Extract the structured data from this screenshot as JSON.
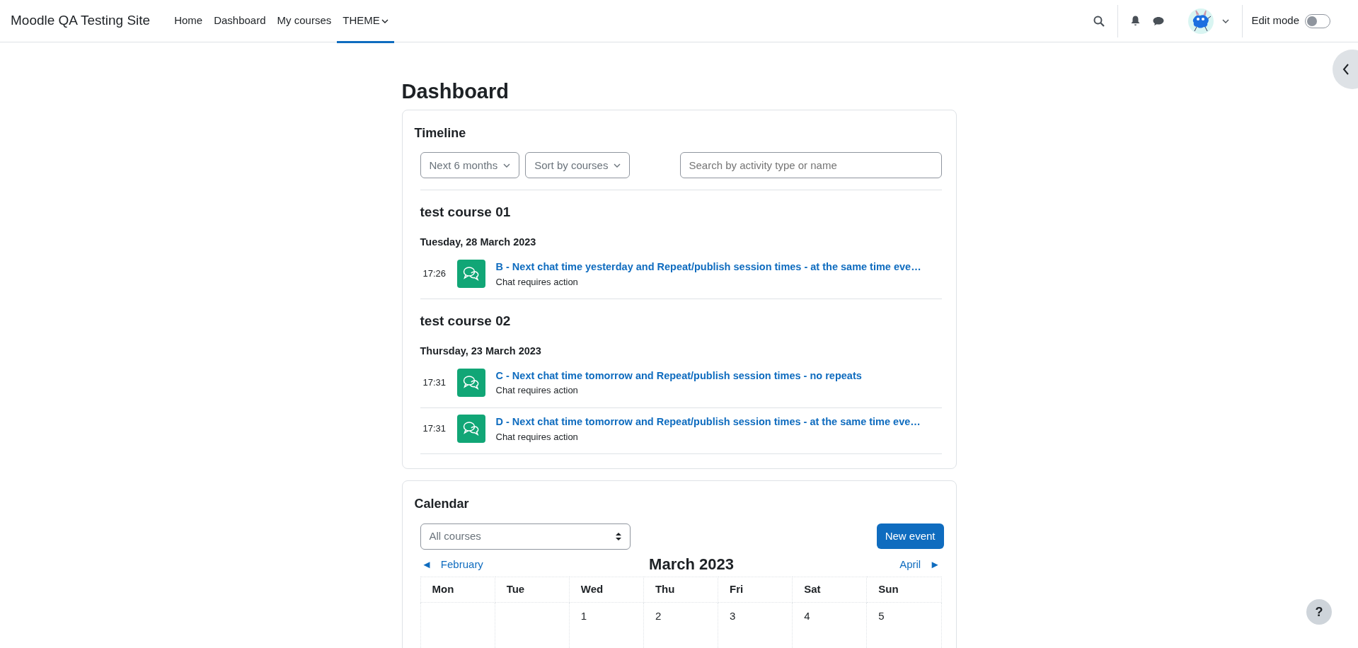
{
  "site_name": "Moodle QA Testing Site",
  "nav_items": [
    {
      "label": "Home",
      "selected": false,
      "dropdown": false
    },
    {
      "label": "Dashboard",
      "selected": false,
      "dropdown": false
    },
    {
      "label": "My courses",
      "selected": false,
      "dropdown": false
    },
    {
      "label": "THEME",
      "selected": true,
      "dropdown": true
    }
  ],
  "edit_mode": {
    "label": "Edit mode",
    "on": false
  },
  "page_title": "Dashboard",
  "timeline": {
    "title": "Timeline",
    "filters": [
      {
        "label": "Next 6 months"
      },
      {
        "label": "Sort by courses"
      }
    ],
    "search": {
      "placeholder": "Search by activity type or name"
    },
    "courses": [
      {
        "name": "test course 01",
        "dates": [
          {
            "date": "Tuesday, 28 March 2023",
            "events": [
              {
                "time": "17:26",
                "title": "B - Next chat time yesterday and Repeat/publish session times - at the same time eve…",
                "subtitle": "Chat requires action"
              }
            ]
          }
        ]
      },
      {
        "name": "test course 02",
        "dates": [
          {
            "date": "Thursday, 23 March 2023",
            "events": [
              {
                "time": "17:31",
                "title": "C - Next chat time tomorrow and Repeat/publish session times - no repeats",
                "subtitle": "Chat requires action"
              },
              {
                "time": "17:31",
                "title": "D - Next chat time tomorrow and Repeat/publish session times - at the same time eve…",
                "subtitle": "Chat requires action"
              }
            ]
          }
        ]
      }
    ]
  },
  "calendar": {
    "title": "Calendar",
    "course_select": {
      "value": "All courses"
    },
    "new_event_button": "New event",
    "prev": {
      "arrow": "◄",
      "label": "February"
    },
    "month_title": "March 2023",
    "next": {
      "label": "April",
      "arrow": "►"
    },
    "weekdays": [
      "Mon",
      "Tue",
      "Wed",
      "Thu",
      "Fri",
      "Sat",
      "Sun"
    ],
    "first_week": [
      {
        "kind": "empty"
      },
      {
        "kind": "empty"
      },
      {
        "kind": "day",
        "label": "1"
      },
      {
        "kind": "day",
        "label": "2"
      },
      {
        "kind": "day",
        "label": "3"
      },
      {
        "kind": "day",
        "label": "4"
      },
      {
        "kind": "day",
        "label": "5"
      }
    ]
  },
  "help_button": "?"
}
